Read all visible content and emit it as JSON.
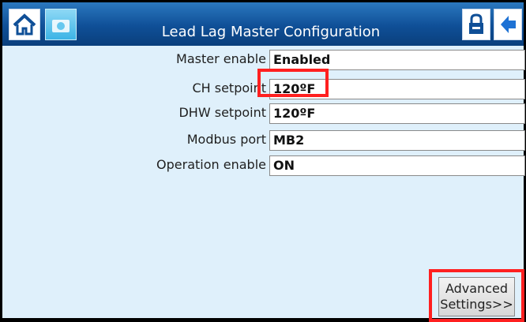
{
  "header": {
    "title": "Lead Lag Master Configuration",
    "icons": {
      "home": "home-icon",
      "camera": "camera-icon",
      "lock": "lock-icon",
      "back": "back-arrow-icon"
    },
    "colors": {
      "titlebar": "#1559a5",
      "content_bg": "#dff0fb",
      "highlight": "#ff2020"
    }
  },
  "settings": {
    "rows": [
      {
        "label": "Master enable",
        "value": "Enabled"
      },
      {
        "label": "CH setpoint",
        "value": "120ºF"
      },
      {
        "label": "DHW setpoint",
        "value": "120ºF"
      },
      {
        "label": "Modbus port",
        "value": "MB2"
      },
      {
        "label": "Operation enable",
        "value": "ON"
      }
    ]
  },
  "footer": {
    "advanced_line1": "Advanced",
    "advanced_line2": "Settings>>"
  }
}
